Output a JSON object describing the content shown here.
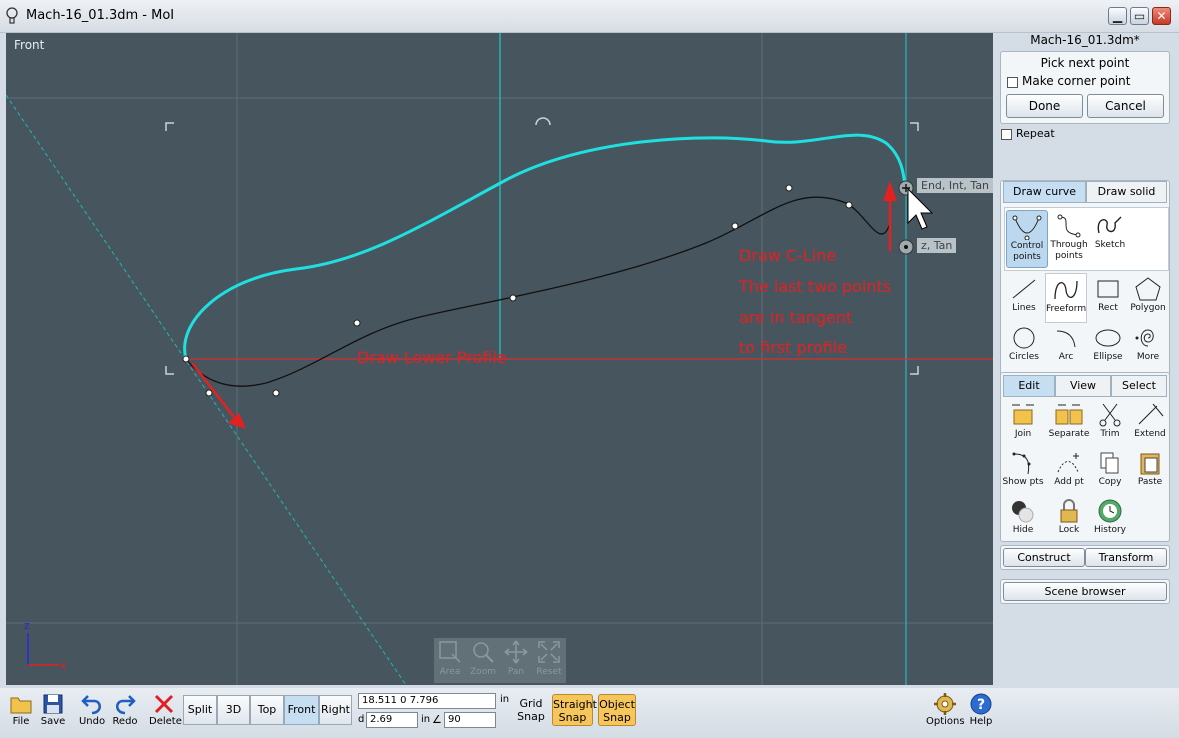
{
  "window": {
    "title": "Mach-16_01.3dm - MoI",
    "minimize": "▁",
    "maximize": "▭",
    "close": "✕"
  },
  "viewport": {
    "label": "Front",
    "snap_tooltip_1": "End, Int, Tan",
    "snap_tooltip_2": "z, Tan",
    "axis_z": "z",
    "axis_x": "x",
    "nav": [
      {
        "label": "Area"
      },
      {
        "label": "Zoom"
      },
      {
        "label": "Pan"
      },
      {
        "label": "Reset"
      }
    ]
  },
  "annotations": {
    "lower_profile": "Draw Lower Profile",
    "cline_1": "Draw C-Line",
    "cline_2": "The last two points",
    "cline_3": "are in tangent",
    "cline_4": "to first profile"
  },
  "panel": {
    "filename": "Mach-16_01.3dm*",
    "prompt": "Pick next point",
    "corner_label": "Make corner point",
    "done": "Done",
    "cancel": "Cancel",
    "repeat_label": "Repeat",
    "draw_tabs": {
      "curve": "Draw curve",
      "solid": "Draw solid"
    },
    "curve_tools": [
      {
        "label1": "Control",
        "label2": "points"
      },
      {
        "label1": "Through",
        "label2": "points"
      },
      {
        "label1": "Sketch",
        "label2": ""
      }
    ],
    "shape_tools": [
      {
        "label": "Lines"
      },
      {
        "label": "Freeform"
      },
      {
        "label": "Rect"
      },
      {
        "label": "Polygon"
      },
      {
        "label": "Circles"
      },
      {
        "label": "Arc"
      },
      {
        "label": "Ellipse"
      },
      {
        "label": "More"
      }
    ],
    "edit_tabs": {
      "edit": "Edit",
      "view": "View",
      "select": "Select"
    },
    "edit_tools": [
      {
        "label": "Join"
      },
      {
        "label": "Separate"
      },
      {
        "label": "Trim"
      },
      {
        "label": "Extend"
      },
      {
        "label": "Show pts"
      },
      {
        "label": "Add pt"
      },
      {
        "label": "Copy"
      },
      {
        "label": "Paste"
      },
      {
        "label": "Hide"
      },
      {
        "label": "Lock"
      },
      {
        "label": "History"
      }
    ],
    "construct": "Construct",
    "transform": "Transform",
    "scene_browser": "Scene browser"
  },
  "bottom": {
    "file": "File",
    "save": "Save",
    "undo": "Undo",
    "redo": "Redo",
    "delete": "Delete",
    "views": [
      {
        "label": "Split"
      },
      {
        "label": "3D"
      },
      {
        "label": "Top"
      },
      {
        "label": "Front"
      },
      {
        "label": "Right"
      }
    ],
    "coords": "18.511     0      7.796",
    "coord_unit": "in",
    "d_label": "d",
    "distance": "2.69",
    "distance_unit": "in",
    "angle_symbol": "∠",
    "angle": "90",
    "grid_snap_1": "Grid",
    "grid_snap_2": "Snap",
    "straight_snap_1": "Straight",
    "straight_snap_2": "Snap",
    "object_snap_1": "Object",
    "object_snap_2": "Snap",
    "options": "Options",
    "help": "Help"
  },
  "colors": {
    "viewport_bg": "#47565e",
    "curve_cyan": "#1fe0e0",
    "annotation_red": "#e42020",
    "snap_on": "#f6c55b"
  }
}
